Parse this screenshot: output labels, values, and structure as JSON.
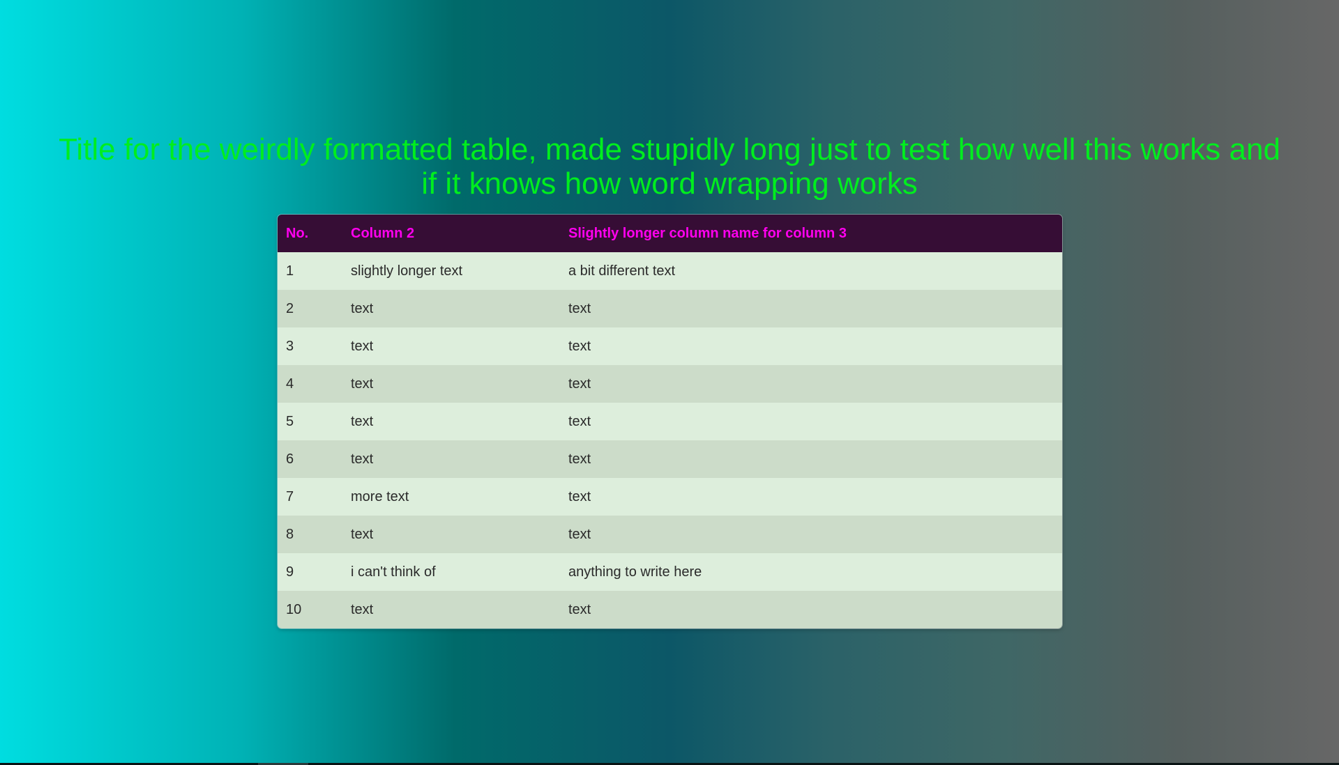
{
  "title": "Title for the weirdly formatted table, made stupidly long just to test how well this works and if it knows how word wrapping works",
  "table": {
    "headers": [
      "No.",
      "Column 2",
      "Slightly longer column name for column 3"
    ],
    "rows": [
      [
        "1",
        "slightly longer text",
        "a bit different text"
      ],
      [
        "2",
        "text",
        "text"
      ],
      [
        "3",
        "text",
        "text"
      ],
      [
        "4",
        "text",
        "text"
      ],
      [
        "5",
        "text",
        "text"
      ],
      [
        "6",
        "text",
        "text"
      ],
      [
        "7",
        "more text",
        "text"
      ],
      [
        "8",
        "text",
        "text"
      ],
      [
        "9",
        "i can't think of",
        "anything to write here"
      ],
      [
        "10",
        "text",
        "text"
      ]
    ]
  },
  "colors": {
    "title": "#00ee1e",
    "header_bg": "#360d35",
    "header_text": "#ff00ee",
    "row_odd": "#ddeedc",
    "row_even": "#ccdcc9"
  }
}
